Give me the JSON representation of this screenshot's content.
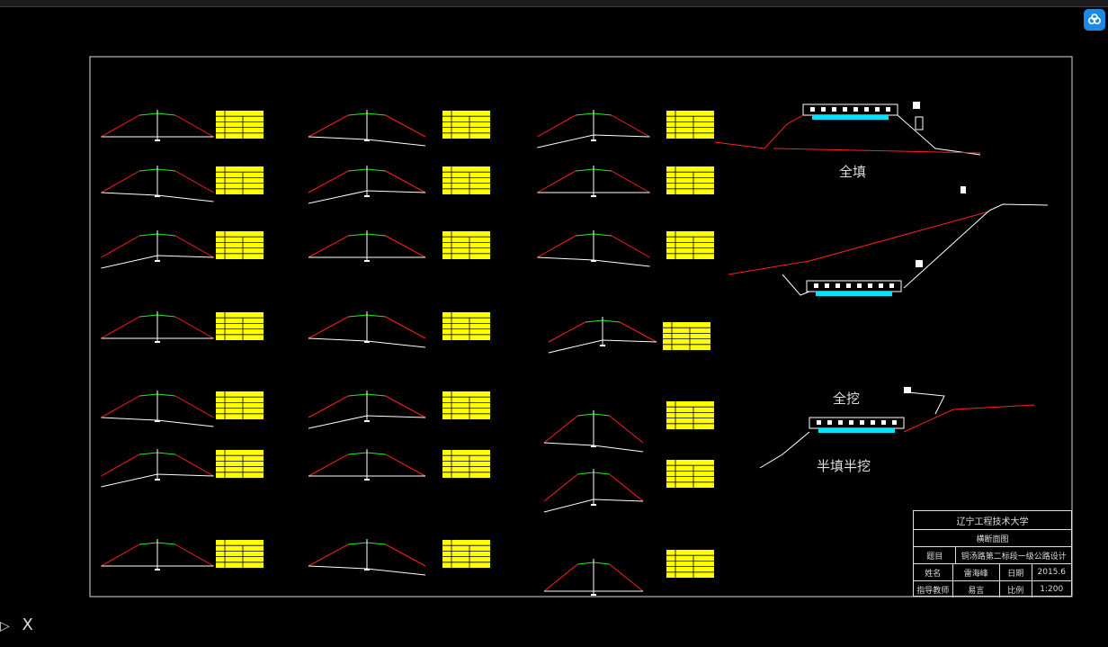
{
  "drawing": {
    "labels": {
      "full_fill": "全填",
      "full_cut": "全挖",
      "half_fill_half_cut": "半填半挖"
    },
    "ucs_axis_label": "X",
    "colors": {
      "background": "#000000",
      "ground_line": "#ff2020",
      "road_line": "#ffffff",
      "pavement": "#22ee22",
      "table_fill": "#ffff00",
      "ditch": "#00e5ff"
    }
  },
  "title_block": {
    "school": "辽宁工程技术大学",
    "drawing_name": "横断面图",
    "topic_label": "题目",
    "topic_value": "铜汤路第二标段一级公路设计",
    "name_label": "姓名",
    "name_value": "雷海峰",
    "date_label": "日期",
    "date_value": "2015.6",
    "advisor_label": "指导教师",
    "advisor_value": "易言",
    "scale_label": "比例",
    "scale_value": "1:200"
  },
  "toolbar": {
    "cloud_icon": "cloud-sync-icon"
  }
}
